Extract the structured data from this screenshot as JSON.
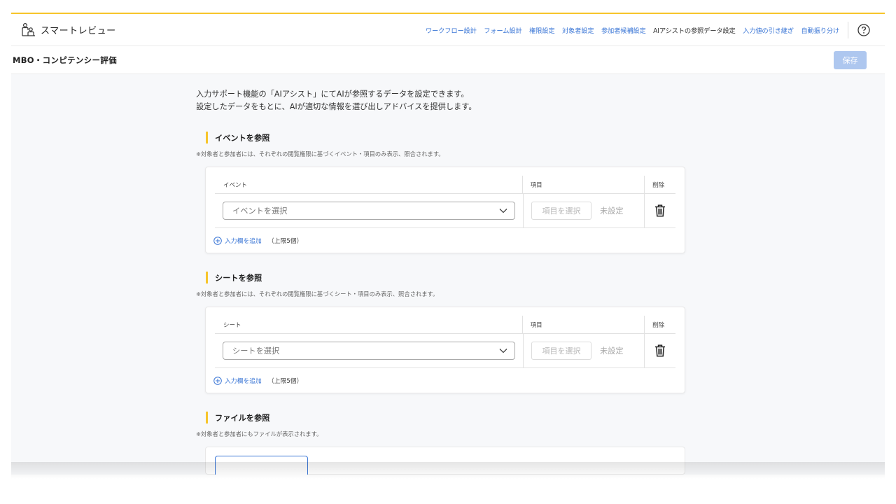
{
  "app": {
    "name": "スマートレビュー",
    "icon": "people-icon"
  },
  "nav": {
    "links": [
      {
        "label": "ワークフロー設計"
      },
      {
        "label": "フォーム設計"
      },
      {
        "label": "権限設定"
      },
      {
        "label": "対象者設定"
      },
      {
        "label": "参加者候補設定"
      },
      {
        "label": "AIアシストの参照データ設定"
      },
      {
        "label": "入力値の引き継ぎ"
      },
      {
        "label": "自動振り分け"
      }
    ],
    "help_icon": "question-circle-icon"
  },
  "page": {
    "title": "MBO・コンピテンシー評価",
    "save_label": "保存"
  },
  "intro": {
    "line1": "入力サポート機能の「AIアシスト」にてAIが参照するデータを設定できます。",
    "line2": "設定したデータをもとに、AIが適切な情報を選び出しアドバイスを提供します。"
  },
  "sections": {
    "event": {
      "title": "イベントを参照",
      "note": "※対象者と参加者には、それぞれの閲覧権限に基づくイベント・項目のみ表示、照合されます。",
      "col_main": "イベント",
      "col_item": "項目",
      "col_delete": "削除",
      "select_placeholder": "イベントを選択",
      "item_button": "項目を選択",
      "item_status": "未設定",
      "add_label": "入力欄を追加",
      "limit": "（上限5個）"
    },
    "sheet": {
      "title": "シートを参照",
      "note": "※対象者と参加者には、それぞれの閲覧権限に基づくシート・項目のみ表示、照合されます。",
      "col_main": "シート",
      "col_item": "項目",
      "col_delete": "削除",
      "select_placeholder": "シートを選択",
      "item_button": "項目を選択",
      "item_status": "未設定",
      "add_label": "入力欄を追加",
      "limit": "（上限5個）"
    },
    "file": {
      "title": "ファイルを参照",
      "note": "※対象者と参加者にもファイルが表示されます。"
    }
  },
  "colors": {
    "accent_yellow": "#f7c52b",
    "link_blue": "#3a76d6",
    "save_disabled": "#aec7ef"
  }
}
